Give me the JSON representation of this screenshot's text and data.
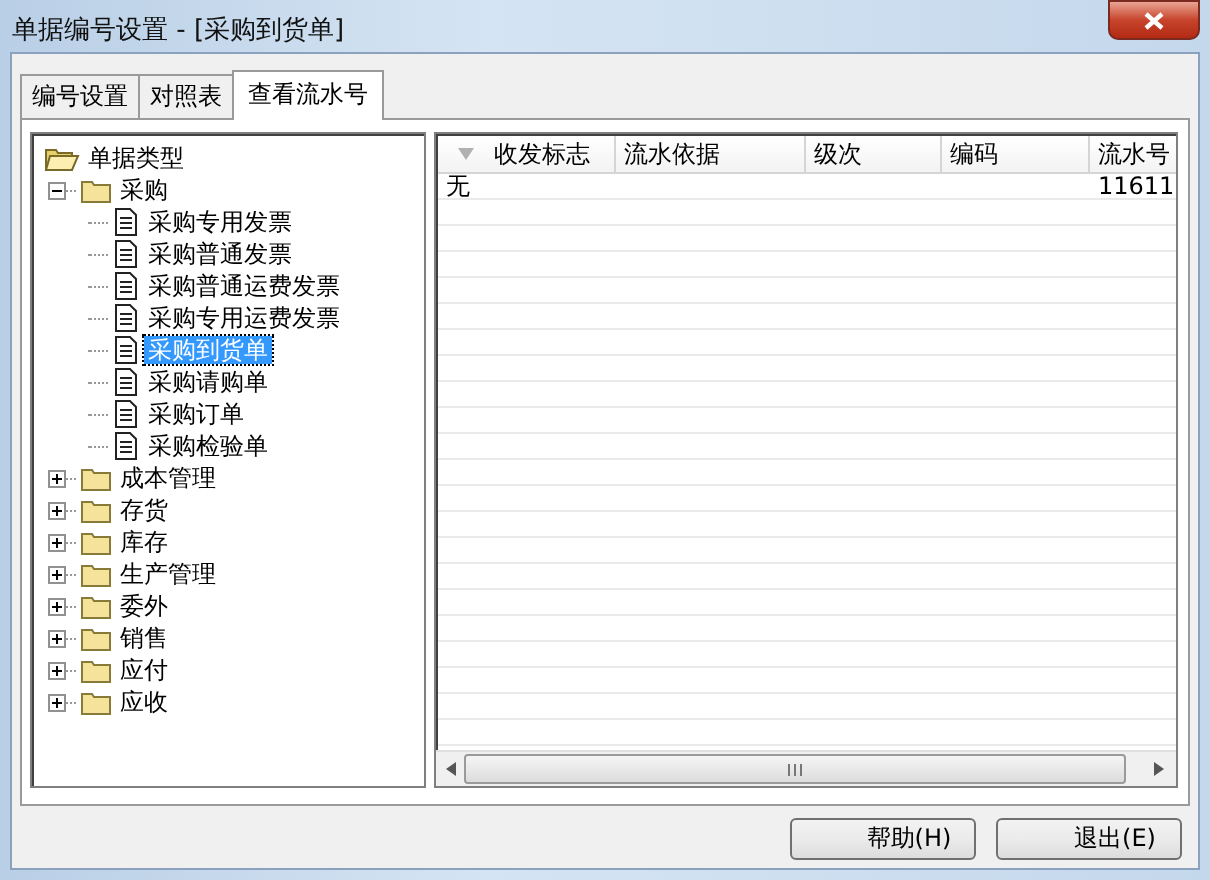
{
  "window": {
    "title": "单据编号设置 - [采购到货单]"
  },
  "tabs": [
    {
      "label": "编号设置",
      "selected": false
    },
    {
      "label": "对照表",
      "selected": false
    },
    {
      "label": "查看流水号",
      "selected": true
    }
  ],
  "tree": {
    "label": "单据类型",
    "kind": "root",
    "children": [
      {
        "label": "采购",
        "kind": "folder",
        "expanded": true,
        "children": [
          {
            "label": "采购专用发票",
            "kind": "document",
            "selected": false
          },
          {
            "label": "采购普通发票",
            "kind": "document",
            "selected": false
          },
          {
            "label": "采购普通运费发票",
            "kind": "document",
            "selected": false
          },
          {
            "label": "采购专用运费发票",
            "kind": "document",
            "selected": false
          },
          {
            "label": "采购到货单",
            "kind": "document",
            "selected": true
          },
          {
            "label": "采购请购单",
            "kind": "document",
            "selected": false
          },
          {
            "label": "采购订单",
            "kind": "document",
            "selected": false
          },
          {
            "label": "采购检验单",
            "kind": "document",
            "selected": false
          }
        ]
      },
      {
        "label": "成本管理",
        "kind": "folder",
        "expanded": false
      },
      {
        "label": "存货",
        "kind": "folder",
        "expanded": false
      },
      {
        "label": "库存",
        "kind": "folder",
        "expanded": false
      },
      {
        "label": "生产管理",
        "kind": "folder",
        "expanded": false
      },
      {
        "label": "委外",
        "kind": "folder",
        "expanded": false
      },
      {
        "label": "销售",
        "kind": "folder",
        "expanded": false
      },
      {
        "label": "应付",
        "kind": "folder",
        "expanded": false
      },
      {
        "label": "应收",
        "kind": "folder",
        "expanded": false
      }
    ]
  },
  "table": {
    "columns": [
      "收发标志",
      "流水依据",
      "级次",
      "编码",
      "流水号"
    ],
    "rows": [
      [
        "无",
        "",
        "",
        "",
        "11611"
      ]
    ]
  },
  "buttons": [
    "帮助(H)",
    "退出(E)"
  ]
}
